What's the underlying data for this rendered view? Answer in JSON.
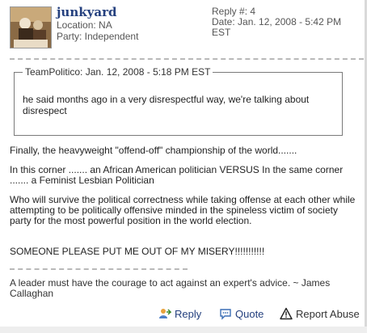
{
  "post": {
    "username": "junkyard",
    "location": "Location: NA",
    "party": "Party: Independent",
    "reply_number": "Reply #: 4",
    "date_line1": "Date: Jan. 12, 2008 - 5:42 PM",
    "date_line2": "EST"
  },
  "quote": {
    "header": "TeamPolitico: Jan. 12, 2008 - 5:18 PM EST",
    "text": "he said months ago in a very disrespectful way, we're talking about disrespect"
  },
  "body": {
    "p1": "Finally, the heavyweight \"offend-off\" championship of the world.......",
    "p2": "In this corner ....... an African American politician VERSUS In the same corner ....... a Feminist Lesbian Politician",
    "p3": "Who will survive the political correctness while taking offense at each other while attempting to be politically offensive minded in the spineless victim of society party for the most powerful position in the world election.",
    "p4": "SOMEONE PLEASE PUT ME OUT OF MY MISERY!!!!!!!!!!!"
  },
  "signature": "A leader must have the courage to act against an expert's advice. ~ James Callaghan",
  "actions": {
    "reply": "Reply",
    "quote": "Quote",
    "report": "Report Abuse"
  },
  "icons": {
    "reply": "reply-person-icon",
    "quote": "speech-bubble-icon",
    "report": "warning-triangle-icon"
  },
  "colors": {
    "username": "#24407e",
    "link": "#24407e",
    "divider": "#b9b9b9"
  }
}
